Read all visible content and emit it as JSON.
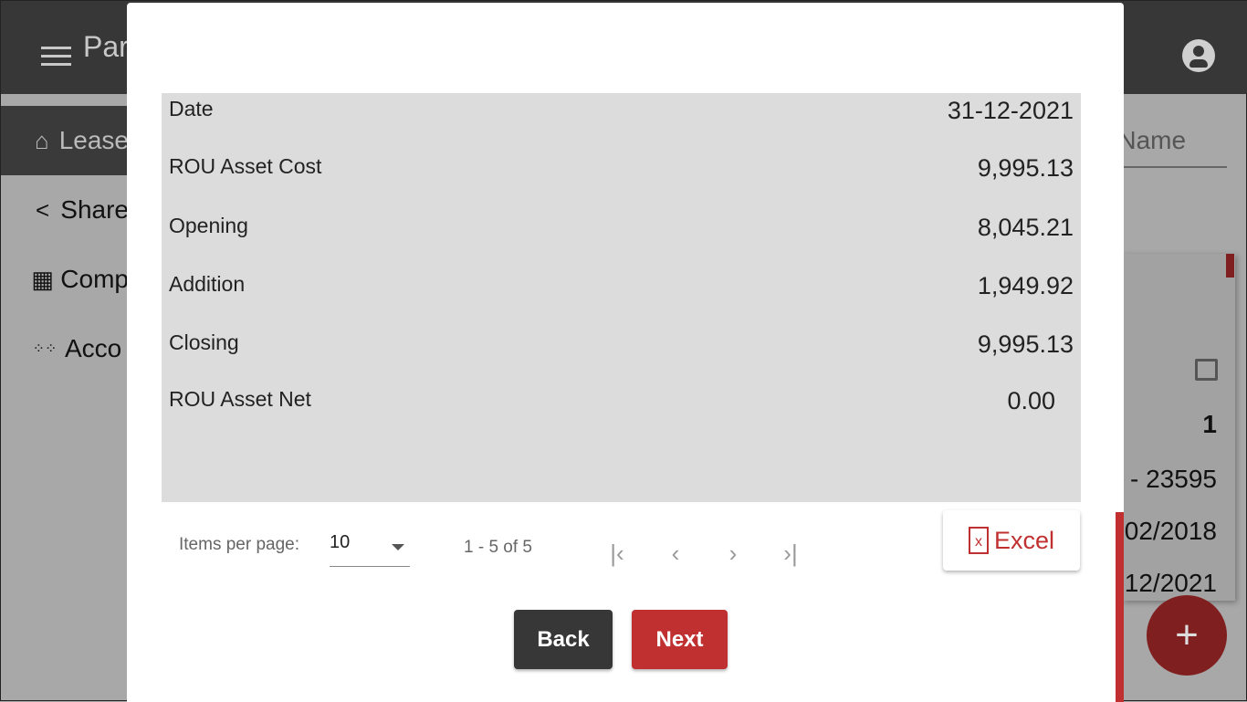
{
  "header": {
    "title": "Par"
  },
  "sidebar": {
    "items": [
      {
        "label": "Lease",
        "icon": "home-icon",
        "active": true
      },
      {
        "label": "Share",
        "icon": "share-icon"
      },
      {
        "label": "Comp",
        "icon": "building-icon"
      },
      {
        "label": "Acco",
        "icon": "dots-icon"
      }
    ]
  },
  "background": {
    "search_placeholder": "e Name",
    "count": "1",
    "row_values": [
      "- 23595",
      "02/2018",
      "12/2021"
    ]
  },
  "modal": {
    "rows": [
      {
        "label": "Date",
        "value": "31-12-2021"
      },
      {
        "label": "ROU Asset Cost",
        "value": "9,995.13"
      },
      {
        "label": "Opening",
        "value": "8,045.21"
      },
      {
        "label": "Addition",
        "value": "1,949.92"
      },
      {
        "label": "Closing",
        "value": "9,995.13"
      },
      {
        "label": "ROU Asset Net",
        "value": "0.00"
      }
    ],
    "paginator": {
      "items_per_page_label": "Items per page:",
      "items_per_page": "10",
      "range": "1 - 5 of 5"
    },
    "excel_label": "Excel",
    "back_label": "Back",
    "next_label": "Next"
  },
  "colors": {
    "accent": "#c03030",
    "dark": "#373737"
  }
}
